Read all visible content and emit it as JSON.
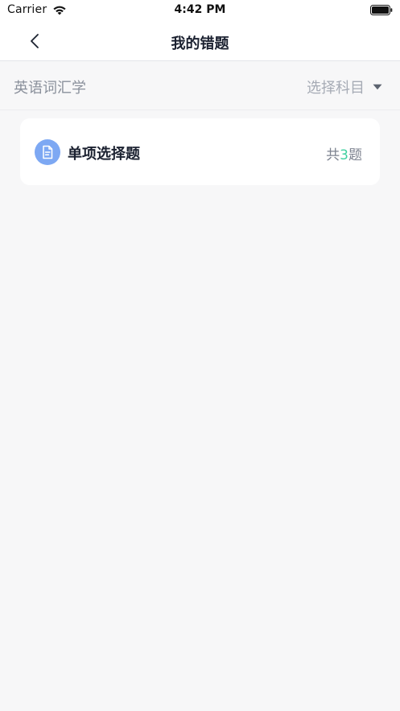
{
  "status_bar": {
    "carrier": "Carrier",
    "time": "4:42 PM"
  },
  "nav": {
    "title": "我的错题",
    "back_icon": "chevron-left-icon"
  },
  "filter": {
    "subject": "英语词汇学",
    "select_label": "选择科目",
    "caret_icon": "caret-down-icon"
  },
  "card": {
    "icon": "document-icon",
    "title": "单项选择题",
    "count_prefix": "共",
    "count": "3",
    "count_suffix": "题"
  },
  "colors": {
    "accent_icon": "#7da8f3",
    "count_highlight": "#3fd0a0",
    "background": "#f7f7f8"
  }
}
